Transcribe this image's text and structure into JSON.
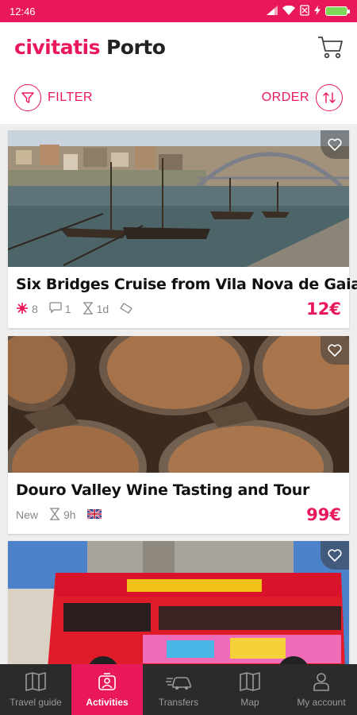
{
  "status_bar": {
    "time": "12:46"
  },
  "header": {
    "brand": "civitatis",
    "city": "Porto"
  },
  "filter_bar": {
    "filter_label": "FILTER",
    "order_label": "ORDER"
  },
  "activities": [
    {
      "title": "Six Bridges Cruise from Vila Nova de Gaia",
      "rating": "8",
      "comments": "1",
      "duration": "1d",
      "price": "12€"
    },
    {
      "title": "Douro Valley Wine Tasting and Tour",
      "badge": "New",
      "duration": "9h",
      "price": "99€"
    },
    {
      "title": ""
    }
  ],
  "bottom_nav": [
    {
      "label": "Travel guide",
      "icon": "guide-book-icon"
    },
    {
      "label": "Activities",
      "icon": "ticket-person-icon",
      "active": true
    },
    {
      "label": "Transfers",
      "icon": "car-icon"
    },
    {
      "label": "Map",
      "icon": "map-icon"
    },
    {
      "label": "My account",
      "icon": "user-icon"
    }
  ],
  "colors": {
    "accent": "#e8185a",
    "nav_bg": "#2b2b2b"
  }
}
